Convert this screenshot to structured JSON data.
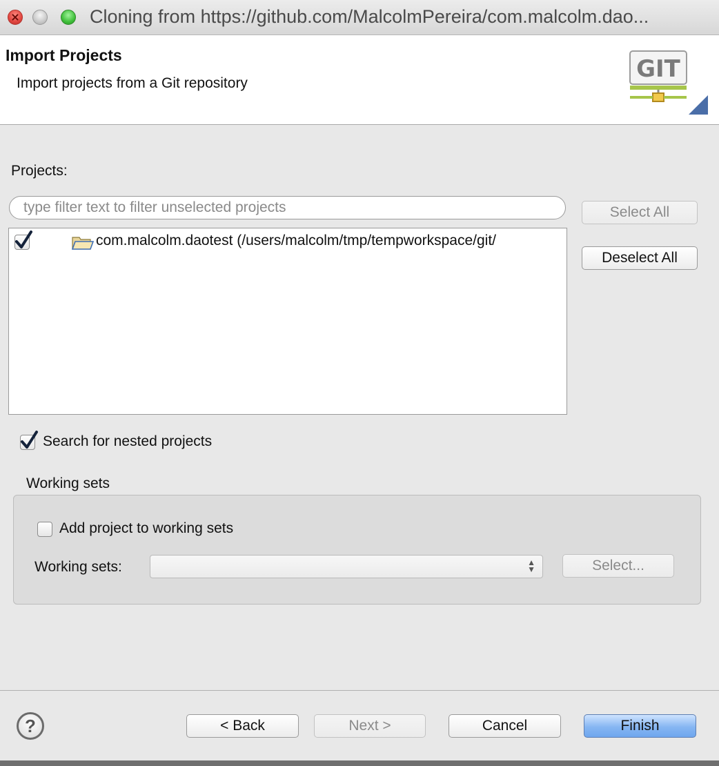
{
  "window": {
    "title": "Cloning from https://github.com/MalcolmPereira/com.malcolm.dao..."
  },
  "header": {
    "title": "Import Projects",
    "subtitle": "Import projects from a Git repository",
    "logo_text": "GIT"
  },
  "projects": {
    "label": "Projects:",
    "filter_placeholder": "type filter text to filter unselected projects",
    "filter_value": "",
    "select_all_label": "Select All",
    "deselect_all_label": "Deselect All",
    "items": [
      {
        "label": "com.malcolm.daotest (/users/malcolm/tmp/tempworkspace/git/",
        "checked": true
      }
    ]
  },
  "options": {
    "search_nested_label": "Search for nested projects",
    "search_nested_checked": true
  },
  "working_sets": {
    "group_label": "Working sets",
    "add_label": "Add project to working sets",
    "add_checked": false,
    "field_label": "Working sets:",
    "selected_value": "",
    "select_button_label": "Select..."
  },
  "footer": {
    "back_label": "< Back",
    "next_label": "Next >",
    "cancel_label": "Cancel",
    "finish_label": "Finish"
  },
  "icons": {
    "help": "?"
  },
  "colors": {
    "background": "#e8e8e8",
    "primary_button": "#86b6f2",
    "checkmark": "#14223a",
    "close_button": "#e0443e",
    "maximize_button": "#3fbf3a"
  }
}
